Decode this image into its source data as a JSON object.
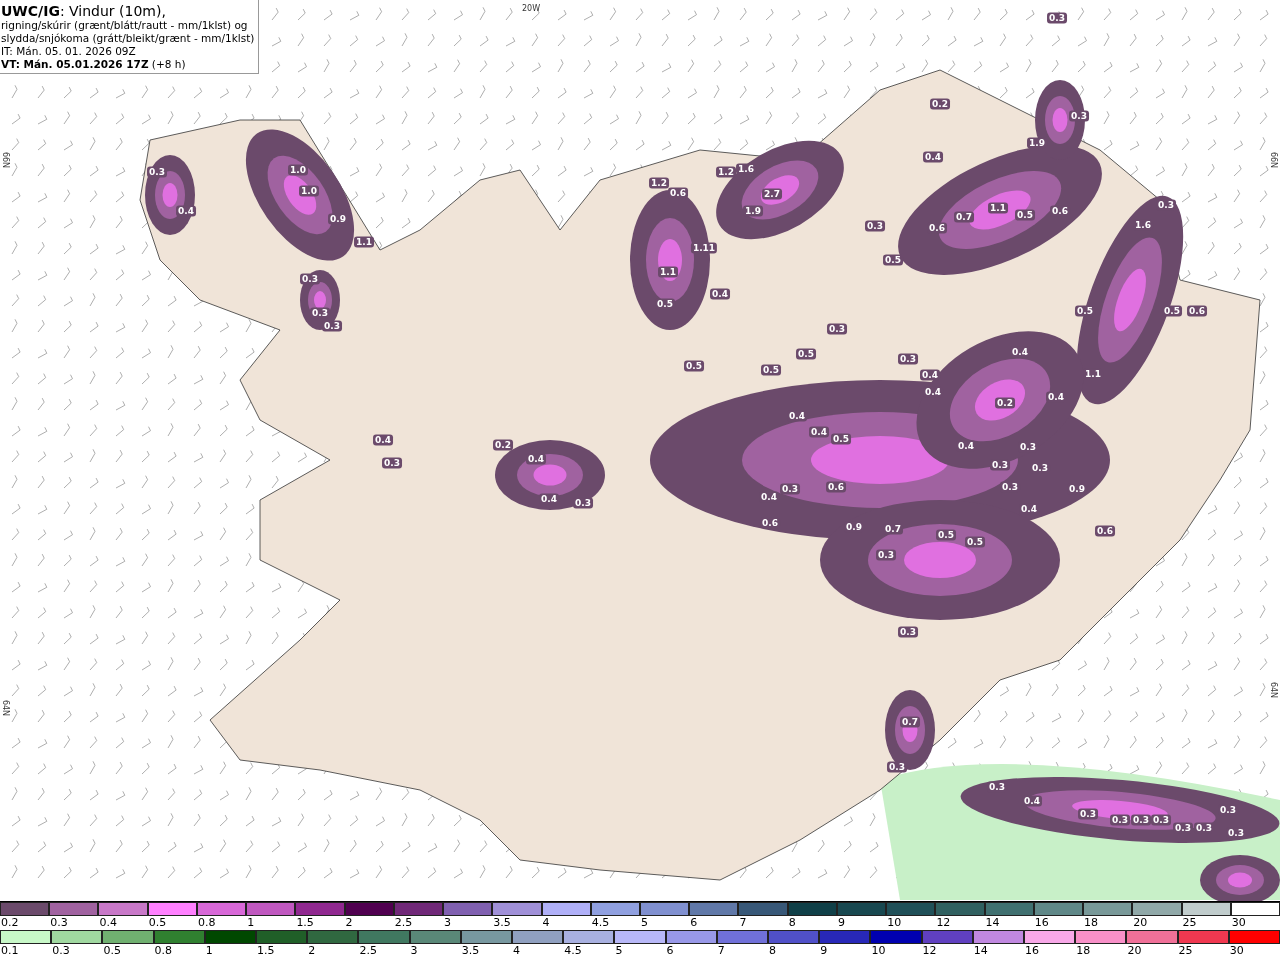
{
  "header": {
    "lines": [
      "**UWC/IG**: Vindur (10m),",
      "rigning/skúrir (grænt/blátt/rautt - mm/1klst) og",
      "slydda/snjókoma (grátt/bleikt/grænt - mm/1klst)",
      "IT: Mán. 05. 01. 2026 09Z",
      "**VT: Mán. 05.01.2026 17Z** (+8 h)"
    ]
  },
  "map": {
    "grid_labels": [
      "20W",
      "66N",
      "66N",
      "64N",
      "64N"
    ],
    "values": [
      "0.3",
      "1.0",
      "1.0",
      "0.4",
      "0.9",
      "1.1",
      "0.3",
      "0.3",
      "0.3",
      "0.3",
      "0.2",
      "0.3",
      "0.4",
      "1.9",
      "1.6",
      "1.2",
      "2.7",
      "1.9",
      "1.2",
      "0.6",
      "0.7",
      "1.1",
      "0.5",
      "0.6",
      "0.3",
      "1.6",
      "0.6",
      "0.5",
      "0.3",
      "1.11",
      "1.1",
      "0.5",
      "0.4",
      "0.3",
      "0.5",
      "0.5",
      "0.5",
      "0.3",
      "0.4",
      "0.4",
      "0.2",
      "0.4",
      "1.1",
      "0.4",
      "0.4",
      "0.5",
      "0.4",
      "0.3",
      "0.4",
      "0.2",
      "0.4",
      "0.3",
      "0.4",
      "0.3",
      "0.3",
      "0.6",
      "0.4",
      "0.6",
      "0.9",
      "0.7",
      "0.5",
      "0.5",
      "0.4",
      "0.9",
      "0.6",
      "0.3",
      "0.3",
      "0.7",
      "0.3",
      "0.3",
      "0.4",
      "0.3",
      "0.3",
      "0.3",
      "0.3",
      "0.3",
      "0.3",
      "0.3",
      "0.3",
      "0.5",
      "0.5",
      "0.6",
      "0.4",
      "0.3",
      "0.3",
      "0.3"
    ]
  },
  "legends": [
    {
      "swatches": [
        {
          "label": "0.2",
          "color": "#6b4a6b"
        },
        {
          "label": "0.3",
          "color": "#a062a0"
        },
        {
          "label": "0.4",
          "color": "#c878c8"
        },
        {
          "label": "0.5",
          "color": "#ff80ff"
        },
        {
          "label": "0.8",
          "color": "#d868d8"
        },
        {
          "label": "1",
          "color": "#c058c0"
        },
        {
          "label": "1.5",
          "color": "#902890"
        },
        {
          "label": "2",
          "color": "#500050"
        },
        {
          "label": "2.5",
          "color": "#702878"
        },
        {
          "label": "3",
          "color": "#8060b0"
        },
        {
          "label": "3.5",
          "color": "#a090d8"
        },
        {
          "label": "4",
          "color": "#b0b0f8"
        },
        {
          "label": "4.5",
          "color": "#90a0e0"
        },
        {
          "label": "5",
          "color": "#8090d0"
        },
        {
          "label": "6",
          "color": "#6078a8"
        },
        {
          "label": "7",
          "color": "#385878"
        },
        {
          "label": "8",
          "color": "#104048"
        },
        {
          "label": "9",
          "color": "#184850"
        },
        {
          "label": "10",
          "color": "#205058"
        },
        {
          "label": "12",
          "color": "#306060"
        },
        {
          "label": "14",
          "color": "#407070"
        },
        {
          "label": "16",
          "color": "#608888"
        },
        {
          "label": "18",
          "color": "#789898"
        },
        {
          "label": "20",
          "color": "#90a8a8"
        },
        {
          "label": "25",
          "color": "#c0cccc"
        },
        {
          "label": "30",
          "color": "#ffffff"
        }
      ]
    },
    {
      "swatches": [
        {
          "label": "0.1",
          "color": "#c8f8c8"
        },
        {
          "label": "0.3",
          "color": "#a0d8a0"
        },
        {
          "label": "0.5",
          "color": "#70b070"
        },
        {
          "label": "0.8",
          "color": "#308030"
        },
        {
          "label": "1",
          "color": "#004800"
        },
        {
          "label": "1.5",
          "color": "#205f28"
        },
        {
          "label": "2",
          "color": "#306840"
        },
        {
          "label": "2.5",
          "color": "#407860"
        },
        {
          "label": "3",
          "color": "#5a8878"
        },
        {
          "label": "3.5",
          "color": "#7898a0"
        },
        {
          "label": "4",
          "color": "#90a0c0"
        },
        {
          "label": "4.5",
          "color": "#a8b0e0"
        },
        {
          "label": "5",
          "color": "#b8b8f8"
        },
        {
          "label": "6",
          "color": "#9898e8"
        },
        {
          "label": "7",
          "color": "#7070d8"
        },
        {
          "label": "8",
          "color": "#5050c8"
        },
        {
          "label": "9",
          "color": "#2828b8"
        },
        {
          "label": "10",
          "color": "#0000b0"
        },
        {
          "label": "12",
          "color": "#6040c0"
        },
        {
          "label": "14",
          "color": "#c088e0"
        },
        {
          "label": "16",
          "color": "#f8a8e8"
        },
        {
          "label": "18",
          "color": "#f890c8"
        },
        {
          "label": "20",
          "color": "#f07098"
        },
        {
          "label": "25",
          "color": "#f03850"
        },
        {
          "label": "30",
          "color": "#ff0000"
        }
      ]
    }
  ]
}
